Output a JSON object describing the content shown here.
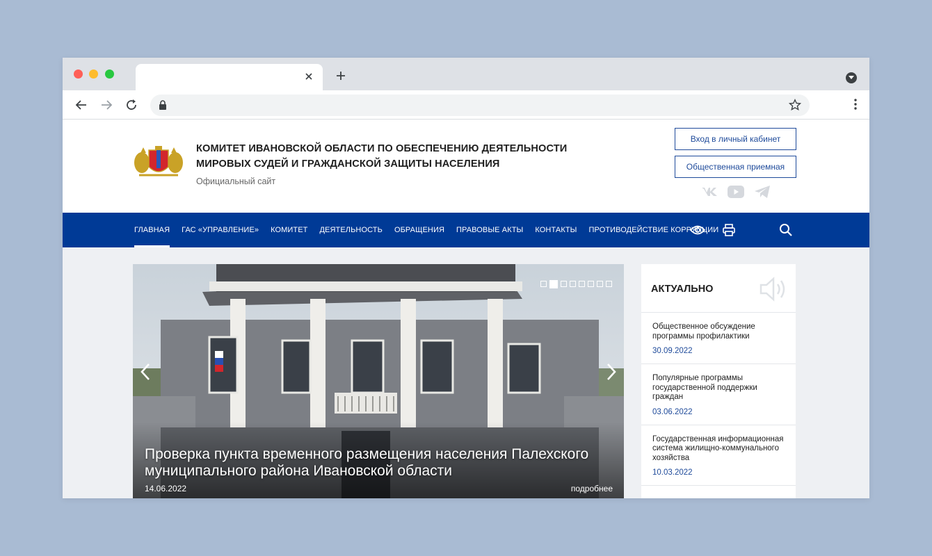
{
  "site": {
    "title_line1": "КОМИТЕТ ИВАНОВСКОЙ ОБЛАСТИ ПО ОБЕСПЕЧЕНИЮ ДЕЯТЕЛЬНОСТИ",
    "title_line2": "МИРОВЫХ СУДЕЙ И ГРАЖДАНСКОЙ ЗАЩИТЫ НАСЕЛЕНИЯ",
    "subtitle": "Официальный сайт",
    "login_button": "Вход в личный кабинет",
    "reception_button": "Общественная приемная"
  },
  "nav": {
    "items": [
      {
        "label": "ГЛАВНАЯ"
      },
      {
        "label": "ГАС «УПРАВЛЕНИЕ»"
      },
      {
        "label": "КОМИТЕТ"
      },
      {
        "label": "ДЕЯТЕЛЬНОСТЬ"
      },
      {
        "label": "ОБРАЩЕНИЯ"
      },
      {
        "label": "ПРАВОВЫЕ АКТЫ"
      },
      {
        "label": "КОНТАКТЫ"
      },
      {
        "label": "ПРОТИВОДЕЙСТВИЕ КОРРУПЦИИ"
      }
    ]
  },
  "slider": {
    "caption": "Проверка пункта временного размещения населения Палехского муниципального района Ивановской области",
    "date": "14.06.2022",
    "more": "подробнее",
    "active_index": 1,
    "total": 8
  },
  "sidebar": {
    "title": "АКТУАЛЬНО",
    "news": [
      {
        "title": "Общественное обсуждение программы профилактики",
        "date": "30.09.2022"
      },
      {
        "title": "Популярные программы государственной поддержки граждан",
        "date": "03.06.2022"
      },
      {
        "title": "Государственная информационная система жилищно-коммунального хозяйства",
        "date": "10.03.2022"
      }
    ]
  },
  "colors": {
    "nav_blue": "#003a96",
    "link_blue": "#1e4a9a",
    "background": "#a9bbd3"
  },
  "icons": {
    "accessibility": "eye-icon",
    "print": "printer-icon",
    "search": "search-icon",
    "vk": "vk-icon",
    "youtube": "youtube-icon",
    "telegram": "telegram-icon",
    "speaker": "speaker-icon"
  }
}
